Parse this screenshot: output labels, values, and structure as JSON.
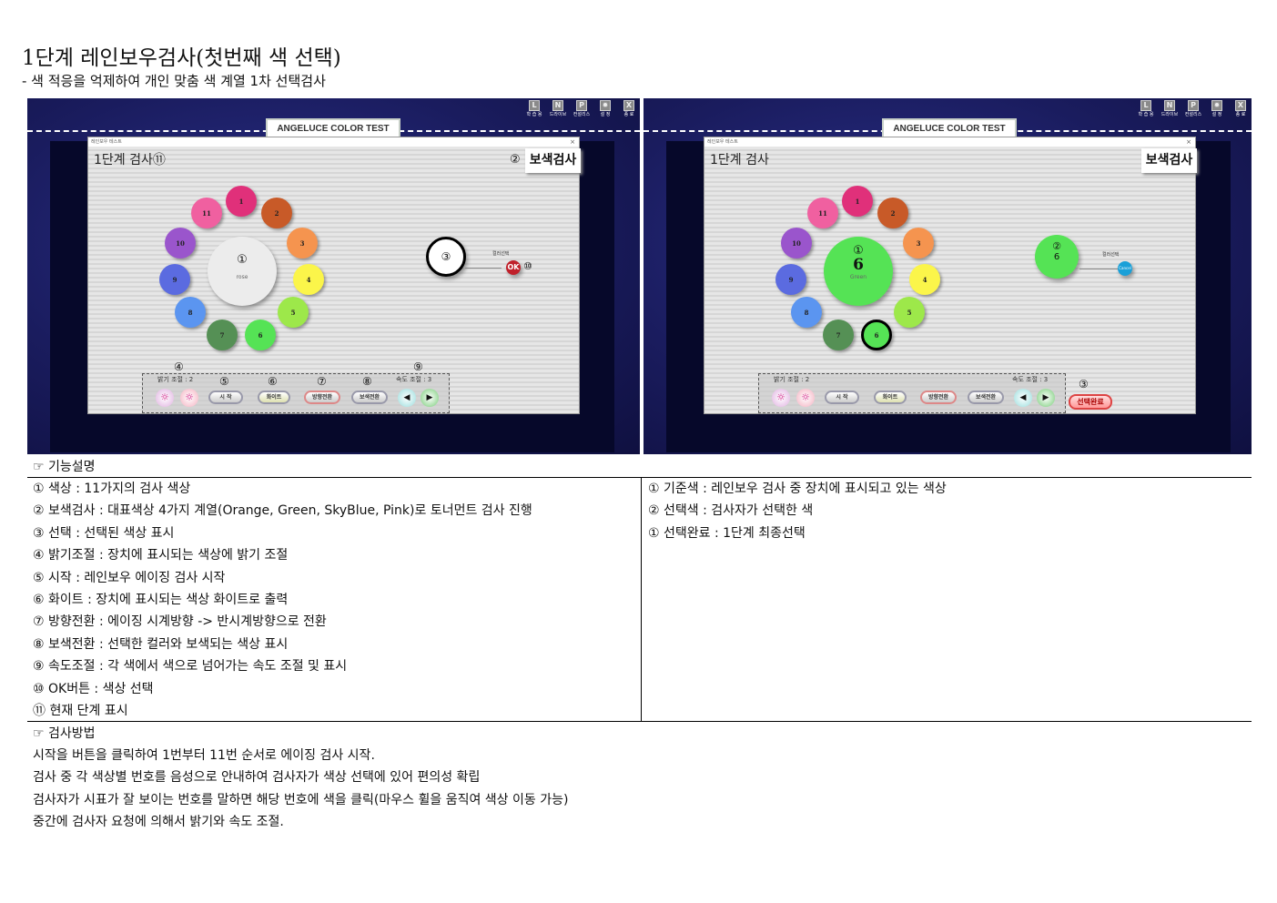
{
  "title": "1단계 레인보우검사(첫번째 색 선택)",
  "subtitle": "- 색 적응을 억제하여 개인 맞춤 색 계열 1차 선택검사",
  "app": {
    "header_tab": "ANGELUCE COLOR TEST",
    "window_title": "레인보우 테스트",
    "close": "×",
    "toolbar": [
      {
        "glyph": "L",
        "label": "학 습 용"
      },
      {
        "glyph": "N",
        "label": "드라이브"
      },
      {
        "glyph": "P",
        "label": "컨설리스"
      },
      {
        "glyph": "✹",
        "label": "설 정"
      },
      {
        "glyph": "X",
        "label": "종 료"
      }
    ],
    "colors": [
      {
        "n": "1",
        "hex": "#e0307a"
      },
      {
        "n": "2",
        "hex": "#c85a28"
      },
      {
        "n": "3",
        "hex": "#f5944f"
      },
      {
        "n": "4",
        "hex": "#fbf54a"
      },
      {
        "n": "5",
        "hex": "#9de84a"
      },
      {
        "n": "6",
        "hex": "#55e355"
      },
      {
        "n": "7",
        "hex": "#559055"
      },
      {
        "n": "8",
        "hex": "#5b95f0"
      },
      {
        "n": "9",
        "hex": "#5b6be0"
      },
      {
        "n": "10",
        "hex": "#9a55cc"
      },
      {
        "n": "11",
        "hex": "#f060a0"
      }
    ],
    "color_select_label": "컬러선택",
    "brightness": "밝기 조절 : 2",
    "speed": "속도 조절 : 3",
    "buttons": {
      "start": "시 작",
      "white": "화이트",
      "direction": "방향전환",
      "complement": "보색전환",
      "prev": "◀",
      "next": "▶",
      "sun": "☼"
    },
    "complement_test": "보색검사"
  },
  "left": {
    "step": "1단계 검사⑪",
    "ann_2": "②",
    "center_mark": "①",
    "center_name": "rose",
    "selected_mark": "③",
    "ok": "OK",
    "ann_10": "⑩",
    "anns": {
      "a4": "④",
      "a5": "⑤",
      "a6": "⑥",
      "a7": "⑦",
      "a8": "⑧",
      "a9": "⑨"
    }
  },
  "right": {
    "step": "1단계 검사",
    "center_mark": "①",
    "center_num": "6",
    "center_name": "Green",
    "selected_mark": "②",
    "selected_num": "6",
    "cancel": "Cancel",
    "ann_3": "③",
    "done": "선택완료",
    "highlight": "6"
  },
  "desc": {
    "header": "☞ 기능설명",
    "left": [
      "① 색상 : 11가지의 검사 색상",
      "② 보색검사 : 대표색상 4가지 계열(Orange, Green, SkyBlue, Pink)로 토너먼트 검사 진행",
      "③ 선택 : 선택된 색상 표시",
      "④ 밝기조절 : 장치에 표시되는 색상에 밝기 조절",
      "⑤ 시작 : 레인보우 에이징 검사 시작",
      "⑥ 화이트 : 장치에 표시되는 색상 화이트로 출력",
      "⑦ 방향전환 : 에이징 시계방향 -> 반시계방향으로 전환",
      "⑧ 보색전환 : 선택한 컬러와 보색되는 색상 표시",
      "⑨ 속도조절 : 각 색에서 색으로 넘어가는 속도 조절 및 표시",
      "⑩ OK버튼 : 색상 선택",
      "⑪ 현재 단계 표시"
    ],
    "right": [
      "① 기준색 : 레인보우 검사 중 장치에 표시되고 있는 색상",
      "② 선택색 : 검사자가 선택한 색",
      "① 선택완료 : 1단계 최종선택"
    ]
  },
  "method": {
    "header": "☞ 검사방법",
    "lines": [
      "시작을 버튼을 클릭하여 1번부터 11번 순서로 에이징 검사 시작.",
      "검사 중 각 색상별 번호를 음성으로 안내하여 검사자가 색상 선택에 있어 편의성 확립",
      "검사자가 시표가 잘 보이는 번호를 말하면 해당 번호에 색을 클릭(마우스 휠을 움직여 색상 이동 가능)",
      "중간에 검사자 요청에 의해서 밝기와 속도 조절."
    ]
  }
}
